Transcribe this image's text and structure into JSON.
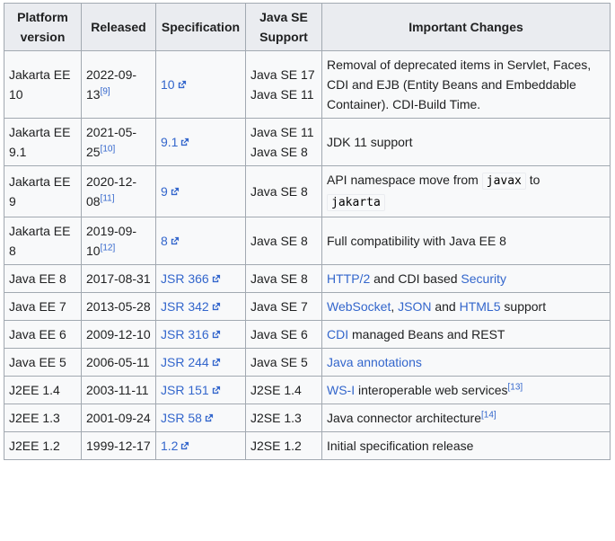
{
  "headers": [
    "Platform version",
    "Released",
    "Specification",
    "Java SE Support",
    "Important Changes"
  ],
  "header_lines": {
    "platform": [
      "Platform",
      "version"
    ],
    "java_se": [
      "Java SE",
      "Support"
    ]
  },
  "rows": [
    {
      "platform": "Jakarta EE 10",
      "released": "2022-09-13",
      "ref": "[9]",
      "spec": "10",
      "java": [
        "Java SE 17",
        "Java SE 11"
      ],
      "changes": "Removal of deprecated items in Servlet, Faces, CDI and EJB (Entity Beans and Embeddable Container). CDI-Build Time."
    },
    {
      "platform": "Jakarta EE 9.1",
      "released": "2021-05-25",
      "ref": "[10]",
      "spec": "9.1",
      "java": [
        "Java SE 11",
        "Java SE 8"
      ],
      "changes": "JDK 11 support"
    },
    {
      "platform": "Jakarta EE 9",
      "released": "2020-12-08",
      "ref": "[11]",
      "spec": "9",
      "java": [
        "Java SE 8"
      ],
      "changes_pre": "API namespace move from",
      "code1": "javax",
      "changes_mid": "to",
      "code2": "jakarta"
    },
    {
      "platform": "Jakarta EE 8",
      "released": "2019-09-10",
      "ref": "[12]",
      "spec": "8",
      "java": [
        "Java SE 8"
      ],
      "changes": "Full compatibility with Java EE 8"
    },
    {
      "platform": "Java EE 8",
      "released": "2017-08-31",
      "spec": "JSR 366",
      "java": [
        "Java SE 8"
      ],
      "link1": "HTTP/2",
      "changes_mid": "and CDI based",
      "link2": "Security"
    },
    {
      "platform": "Java EE 7",
      "released": "2013-05-28",
      "spec": "JSR 342",
      "java": [
        "Java SE 7"
      ],
      "link1": "WebSocket",
      "sep1": ",",
      "link2": "JSON",
      "sep2": "and",
      "link3": "HTML5",
      "tail": "support"
    },
    {
      "platform": "Java EE 6",
      "released": "2009-12-10",
      "spec": "JSR 316",
      "java": [
        "Java SE 6"
      ],
      "link1": "CDI",
      "tail": "managed Beans and REST"
    },
    {
      "platform": "Java EE 5",
      "released": "2006-05-11",
      "spec": "JSR 244",
      "java": [
        "Java SE 5"
      ],
      "link1": "Java annotations"
    },
    {
      "platform": "J2EE 1.4",
      "released": "2003-11-11",
      "spec": "JSR 151",
      "java": [
        "J2SE 1.4"
      ],
      "link1": "WS-I",
      "tail": "interoperable web services",
      "ref": "[13]"
    },
    {
      "platform": "J2EE 1.3",
      "released": "2001-09-24",
      "spec": "JSR 58",
      "java": [
        "J2SE 1.3"
      ],
      "changes": "Java connector architecture",
      "ref": "[14]"
    },
    {
      "platform": "J2EE 1.2",
      "released": "1999-12-17",
      "spec": "1.2",
      "java": [
        "J2SE 1.2"
      ],
      "changes": "Initial specification release"
    }
  ],
  "colors": {
    "link": "#3366cc",
    "border": "#a2a9b1",
    "header_bg": "#eaecf0",
    "cell_bg": "#f8f9fa"
  },
  "icons": {
    "external_link": "external-link-icon"
  }
}
